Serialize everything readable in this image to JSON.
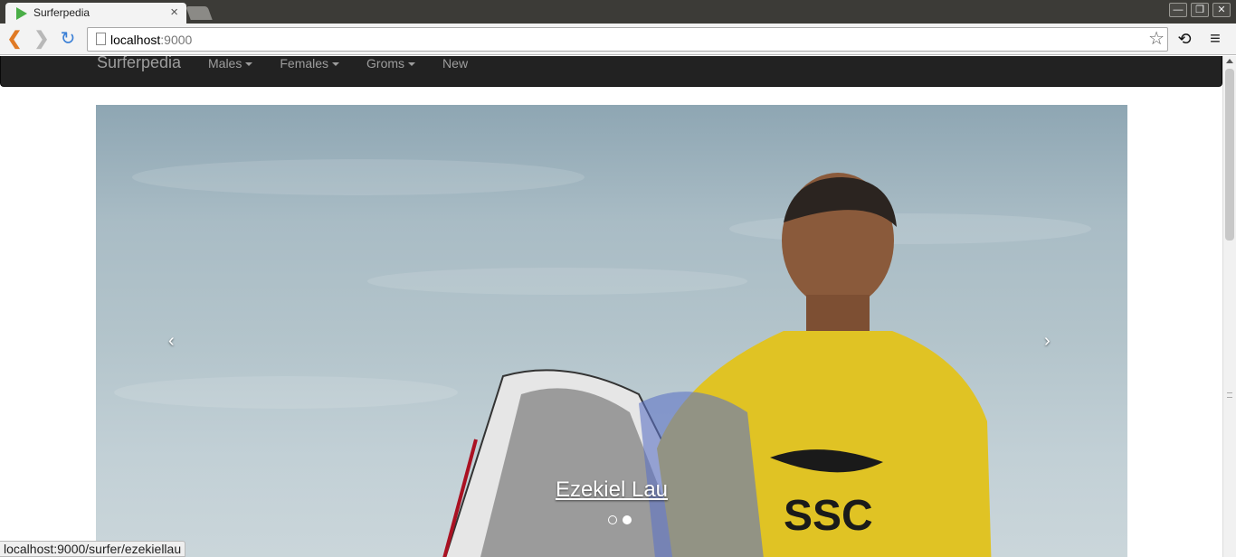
{
  "browser": {
    "tab_title": "Surferpedia",
    "tab_close": "×",
    "url_host": "localhost",
    "url_port": ":9000",
    "window_buttons": [
      "—",
      "❐",
      "✕"
    ],
    "status_url": "localhost:9000/surfer/ezekiellau",
    "icons": {
      "back": "back-arrow-icon",
      "forward": "forward-arrow-icon",
      "reload": "reload-icon",
      "star": "bookmark-star-icon",
      "extension": "extension-icon",
      "menu": "menu-icon"
    }
  },
  "navbar": {
    "brand": "Surferpedia",
    "items": [
      {
        "label": "Males",
        "dropdown": true
      },
      {
        "label": "Females",
        "dropdown": true
      },
      {
        "label": "Groms",
        "dropdown": true
      },
      {
        "label": "New",
        "dropdown": false
      }
    ]
  },
  "carousel": {
    "prev_label": "‹",
    "next_label": "›",
    "caption": "Ezekiel Lau",
    "indicator_count": 2,
    "active_index": 1
  },
  "colors": {
    "navbar_bg": "#222222",
    "nav_text": "#9d9d9d",
    "accent_reload": "#3a7fd6",
    "back_arrow": "#e07a25"
  }
}
